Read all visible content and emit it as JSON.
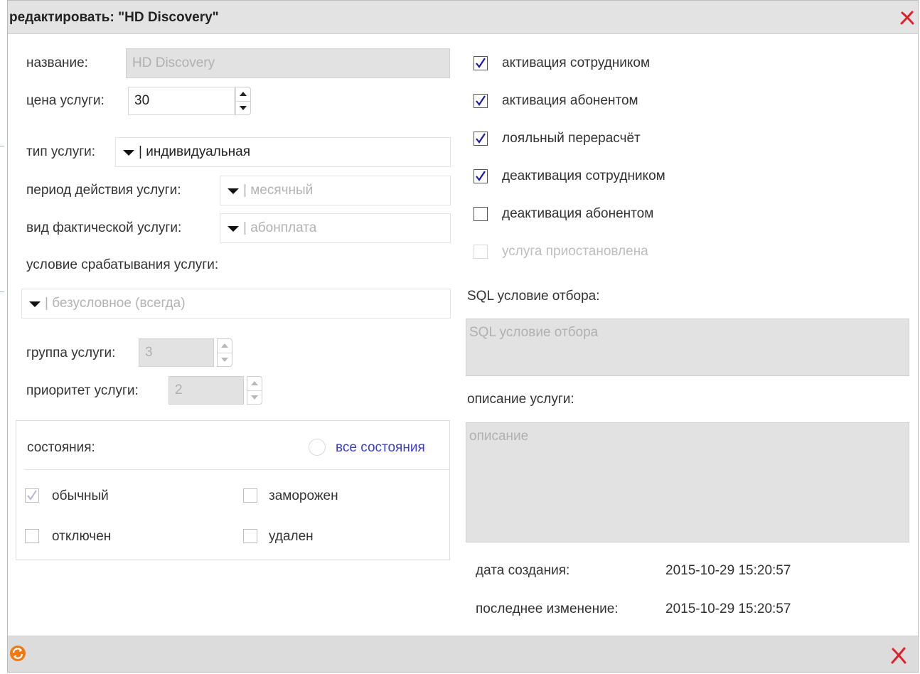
{
  "dialog": {
    "title": "редактировать: \"HD Discovery\"",
    "accent_close_color": "#e0202a",
    "close_icon": "close-x-icon",
    "refresh_icon": "refresh-icon"
  },
  "form": {
    "name_label": "название:",
    "name_value": "HD Discovery",
    "price_label": "цена услуги:",
    "price_value": "30",
    "type_label": "тип услуги:",
    "type_value": "| индивидуальная",
    "period_label": "период действия услуги:",
    "period_value": "| месячный",
    "kind_label": "вид фактической услуги:",
    "kind_value": "| абонплата",
    "condition_label": "условие срабатывания услуги:",
    "condition_value": "| безусловное (всегда)",
    "group_label": "группа услуги:",
    "group_value": "3",
    "priority_label": "приоритет услуги:",
    "priority_value": "2"
  },
  "states": {
    "label": "состояния:",
    "all_label": "все состояния",
    "all_color": "#3b3bdc",
    "items": [
      {
        "label": "обычный",
        "checked": true
      },
      {
        "label": "заморожен",
        "checked": false
      },
      {
        "label": "отключен",
        "checked": false
      },
      {
        "label": "удален",
        "checked": false
      }
    ]
  },
  "options": [
    {
      "label": "активация сотрудником",
      "checked": true
    },
    {
      "label": "активация абонентом",
      "checked": true
    },
    {
      "label": "лояльный перерасчёт",
      "checked": true
    },
    {
      "label": "деактивация сотрудником",
      "checked": true
    },
    {
      "label": "деактивация абонентом",
      "checked": false
    },
    {
      "label": "услуга приостановлена",
      "checked": false,
      "disabled": true
    }
  ],
  "sql": {
    "label": "SQL условие отбора:",
    "placeholder": "SQL условие отбора"
  },
  "description": {
    "label": "описание услуги:",
    "placeholder": "описание"
  },
  "meta": {
    "created_label": "дата создания:",
    "created_value": "2015-10-29 15:20:57",
    "modified_label": "последнее изменение:",
    "modified_value": "2015-10-29 15:20:57"
  },
  "check_color": "#1a1aa8"
}
